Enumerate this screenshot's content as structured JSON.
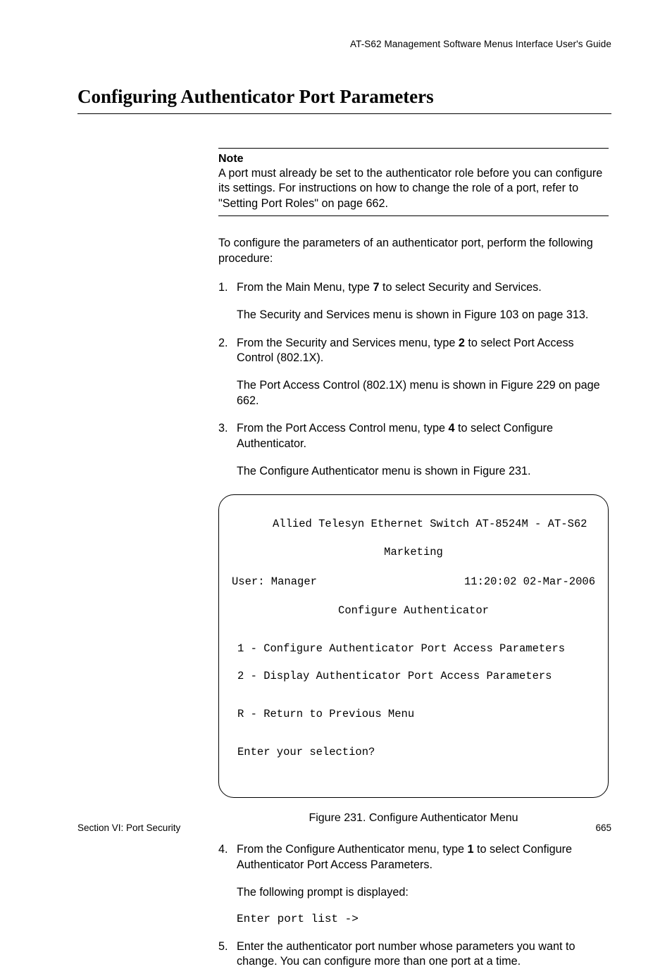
{
  "header": {
    "running": "AT-S62 Management Software Menus Interface User's Guide"
  },
  "title": "Configuring Authenticator Port Parameters",
  "note": {
    "label": "Note",
    "body": "A port must already be set to the authenticator role before you can configure its settings. For instructions on how to change the role of a port, refer to \"Setting Port Roles\" on page 662."
  },
  "intro": "To configure the parameters of an authenticator port, perform the following procedure:",
  "steps": [
    {
      "pre": "From the Main Menu, type ",
      "bold": "7",
      "post": " to select Security and Services.",
      "sub": "The Security and Services menu is shown in Figure 103 on page 313."
    },
    {
      "pre": "From the Security and Services menu, type ",
      "bold": "2",
      "post": " to select Port Access Control (802.1X).",
      "sub": "The Port Access Control (802.1X) menu is shown in Figure 229 on page 662."
    },
    {
      "pre": "From the Port Access Control menu, type ",
      "bold": "4",
      "post": " to select Configure Authenticator.",
      "sub": "The Configure Authenticator menu is shown in Figure 231."
    },
    {
      "pre": "From the Configure Authenticator menu, type ",
      "bold": "1",
      "post": " to select Configure Authenticator Port Access Parameters.",
      "sub": "The following prompt is displayed:",
      "mono": "Enter port list ->"
    },
    {
      "pre": "Enter the authenticator port number whose parameters you want to change. You can configure more than one port at a time.",
      "bold": "",
      "post": "",
      "sub": ""
    }
  ],
  "terminal": {
    "line1": "Allied Telesyn Ethernet Switch AT-8524M - AT-S62",
    "line2": "Marketing",
    "user": "User: Manager",
    "datetime": "11:20:02 02-Mar-2006",
    "menu_title": "Configure Authenticator",
    "opt1": "1 - Configure Authenticator Port Access Parameters",
    "opt2": "2 - Display Authenticator Port Access Parameters",
    "ret": "R - Return to Previous Menu",
    "prompt": "Enter your selection?"
  },
  "figure_caption": "Figure 231. Configure Authenticator Menu",
  "footer": {
    "left": "Section VI: Port Security",
    "right": "665"
  }
}
